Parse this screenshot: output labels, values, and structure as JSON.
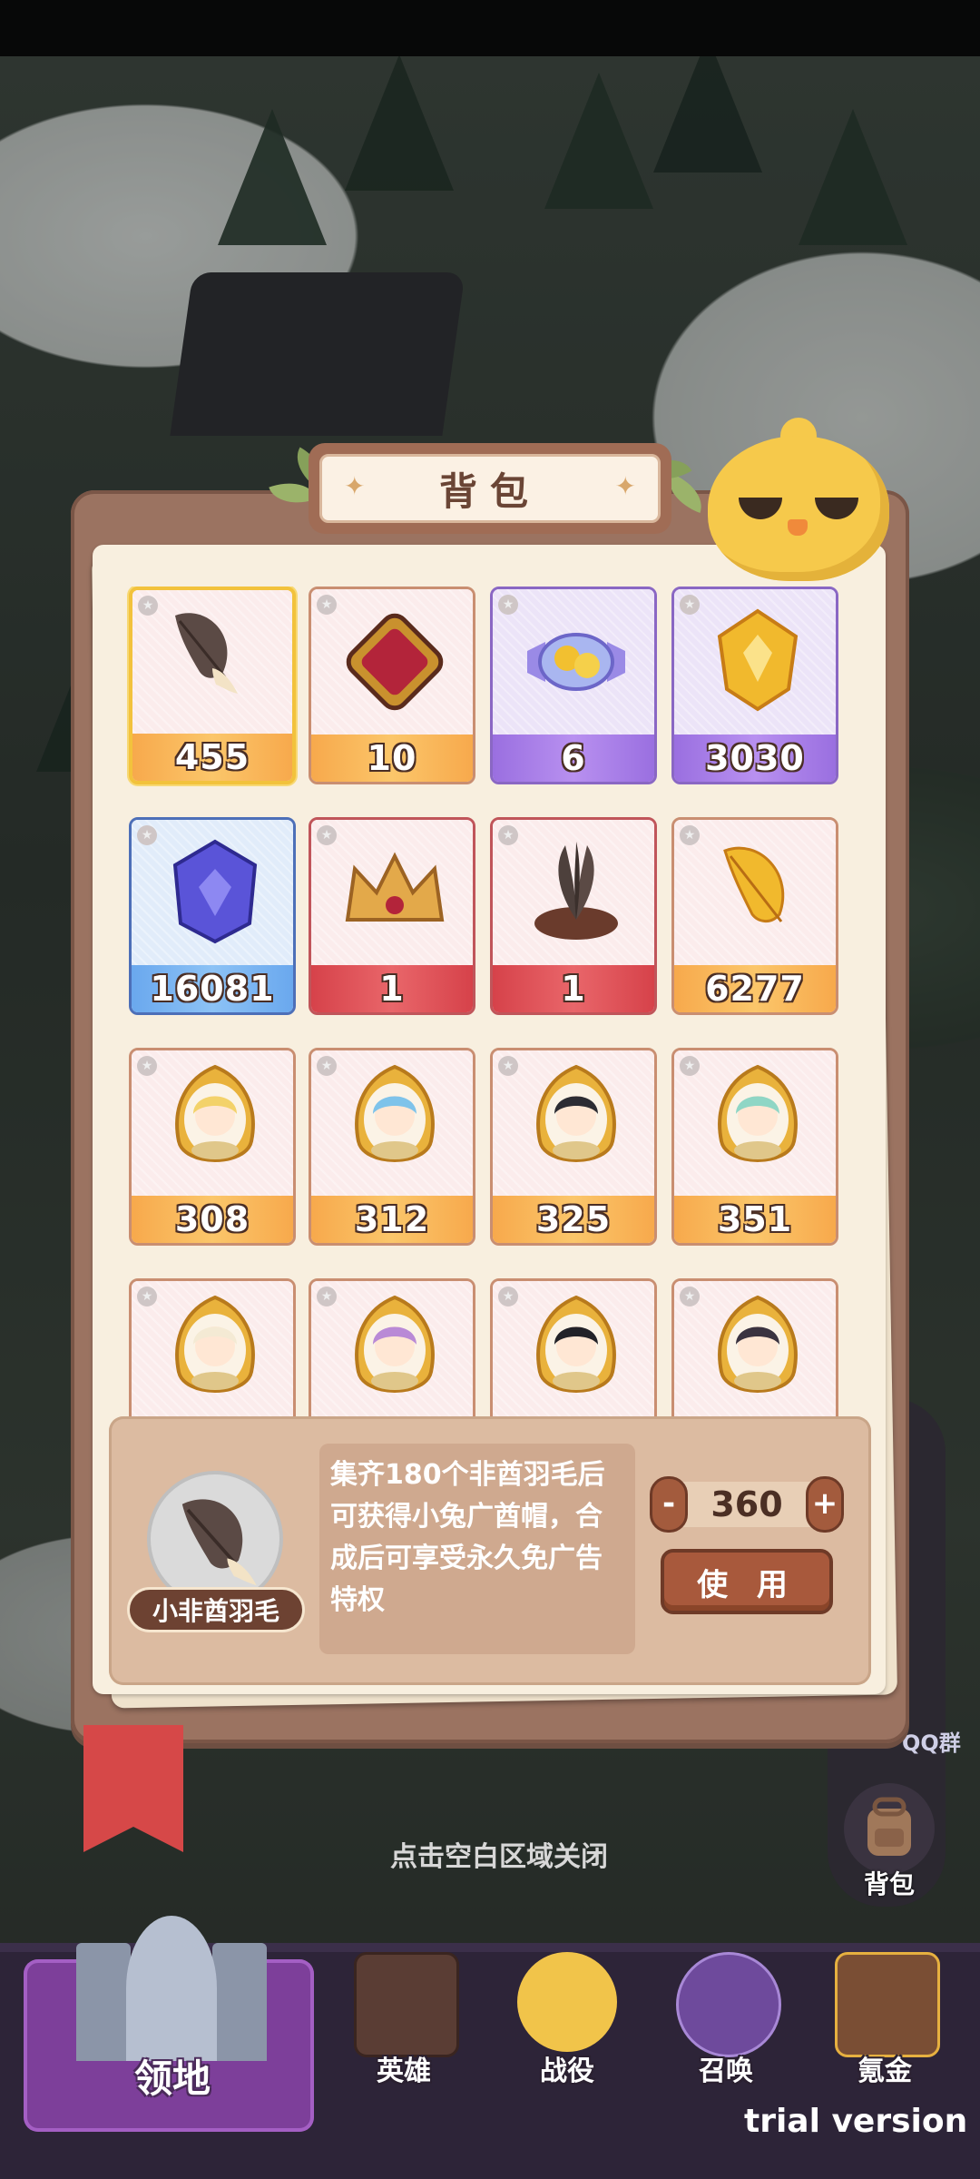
{
  "panel": {
    "title": "背包",
    "close_hint": "点击空白区域关闭"
  },
  "items": [
    {
      "name": "feather",
      "count": "455",
      "band": "orange",
      "border": "sel",
      "icon": "feather-icon"
    },
    {
      "name": "red-gem",
      "count": "10",
      "band": "orange",
      "border": "",
      "icon": "red-gem-icon"
    },
    {
      "name": "candy",
      "count": "6",
      "band": "purple",
      "border": "b-purple",
      "icon": "candy-icon"
    },
    {
      "name": "gold-crystal",
      "count": "3030",
      "band": "purple",
      "border": "b-purple",
      "icon": "gold-crystal-icon"
    },
    {
      "name": "blue-crystal",
      "count": "16081",
      "band": "blue",
      "border": "b-blue",
      "icon": "blue-crystal-icon"
    },
    {
      "name": "crown",
      "count": "1",
      "band": "red",
      "border": "b-red",
      "icon": "crown-icon"
    },
    {
      "name": "feather-hat",
      "count": "1",
      "band": "red",
      "border": "b-red",
      "icon": "feather-hat-icon"
    },
    {
      "name": "gold-feather",
      "count": "6277",
      "band": "orange",
      "border": "",
      "icon": "gold-feather-icon"
    },
    {
      "name": "hero-card-1",
      "count": "308",
      "band": "orange",
      "border": "",
      "icon": "hero-portrait-icon",
      "hair": "#f3d26a"
    },
    {
      "name": "hero-card-2",
      "count": "312",
      "band": "orange",
      "border": "",
      "icon": "hero-portrait-icon",
      "hair": "#7ec3ea"
    },
    {
      "name": "hero-card-3",
      "count": "325",
      "band": "orange",
      "border": "",
      "icon": "hero-portrait-icon",
      "hair": "#2c2c33"
    },
    {
      "name": "hero-card-4",
      "count": "351",
      "band": "orange",
      "border": "",
      "icon": "hero-portrait-icon",
      "hair": "#8fd6c5"
    },
    {
      "name": "hero-card-5",
      "count": "",
      "band": "orange",
      "border": "",
      "icon": "hero-portrait-icon",
      "hair": "#f4ead4"
    },
    {
      "name": "hero-card-6",
      "count": "",
      "band": "orange",
      "border": "",
      "icon": "hero-portrait-icon",
      "hair": "#b98ad6"
    },
    {
      "name": "hero-card-7",
      "count": "",
      "band": "orange",
      "border": "",
      "icon": "hero-portrait-icon",
      "hair": "#222228"
    },
    {
      "name": "hero-card-8",
      "count": "",
      "band": "orange",
      "border": "",
      "icon": "hero-portrait-icon",
      "hair": "#3a3340"
    }
  ],
  "detail": {
    "name": "小非酋羽毛",
    "description": "集齐180个非酋羽毛后可获得小兔广酋帽，合成后可享受永久免广告特权",
    "quantity": "360",
    "minus": "-",
    "plus": "+",
    "use_label": "使 用"
  },
  "side": {
    "qq_label": "QQ群",
    "bag_label": "背包"
  },
  "nav": {
    "home": "领地",
    "heroes": "英雄",
    "battle": "战役",
    "summon": "召唤",
    "shop": "氪金"
  },
  "watermark": "trial version",
  "colors": {
    "panel": "#9b7361",
    "paper": "#f8efdf",
    "accent": "#a8593c",
    "nav_bg": "#2d2438"
  }
}
